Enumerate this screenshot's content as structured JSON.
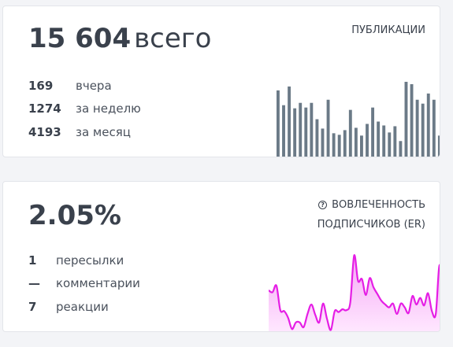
{
  "publications": {
    "total_value": "15 604",
    "total_suffix": "всего",
    "title": "ПУБЛИКАЦИИ",
    "stats": [
      {
        "value": "169",
        "label": "вчера"
      },
      {
        "value": "1274",
        "label": "за неделю"
      },
      {
        "value": "4193",
        "label": "за месяц"
      }
    ]
  },
  "engagement": {
    "value": "2.05%",
    "title_line1": "ВОВЛЕЧЕННОСТЬ",
    "title_line2": "ПОДПИСЧИКОВ (ER)",
    "info_icon": "info-icon",
    "stats": [
      {
        "value": "1",
        "label": "пересылки"
      },
      {
        "value": "—",
        "label": "комментарии"
      },
      {
        "value": "7",
        "label": "реакции"
      }
    ]
  },
  "chart_data": [
    {
      "type": "bar",
      "color": "#6b7a87",
      "values": [
        92,
        73,
        97,
        69,
        76,
        70,
        76,
        55,
        43,
        80,
        37,
        35,
        41,
        67,
        44,
        34,
        49,
        70,
        52,
        47,
        38,
        46,
        27,
        103,
        100,
        80,
        75,
        88,
        80,
        34
      ],
      "ylim": [
        0,
        105
      ]
    },
    {
      "type": "area",
      "color": "#e51ee5",
      "fill_top": "#f5a8f5",
      "fill_bottom": "#ffe8ff",
      "values": [
        45,
        43,
        50,
        24,
        23,
        16,
        4,
        11,
        11,
        6,
        20,
        30,
        19,
        11,
        31,
        15,
        3,
        23,
        22,
        25,
        24,
        32,
        82,
        55,
        57,
        40,
        58,
        48,
        41,
        34,
        30,
        27,
        31,
        20,
        31,
        27,
        21,
        39,
        30,
        37,
        29,
        42,
        23,
        20,
        72,
        20
      ],
      "ylim": [
        0,
        100
      ]
    }
  ]
}
